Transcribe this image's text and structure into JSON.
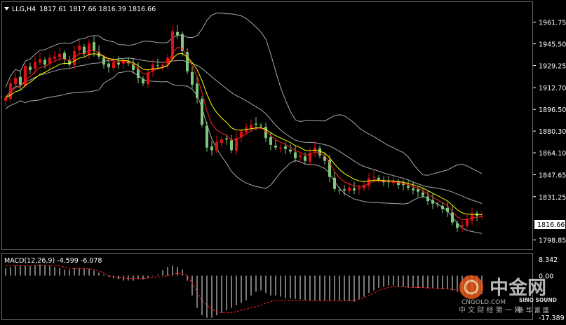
{
  "header": {
    "symbol_timeframe": "LLG,H4",
    "ohlc": "1817.61 1817.66 1816.39 1816.66"
  },
  "colors": {
    "background": "#000000",
    "up_candle": "#e01010",
    "down_candle": "#7ec87e",
    "bollinger": "#a8a8a8",
    "ma_fast": "#ffff00",
    "ma_slow": "#ff2020",
    "histogram": "#c8c8c8",
    "signal": "#ff2020",
    "price_tag_bg": "#ffffff",
    "axis_text": "#ffffff"
  },
  "price_axis": {
    "ticks": [
      "1961.75",
      "1945.50",
      "1929.25",
      "1912.70",
      "1896.50",
      "1880.30",
      "1864.10",
      "1847.65",
      "1831.25",
      "1798.85"
    ],
    "current_price_tag": "1816.66"
  },
  "macd": {
    "label": "MACD(12,26,9) -4.599 -6.078",
    "ticks": [
      "8.342",
      "0.00",
      "-17.389"
    ]
  },
  "watermark": {
    "brand_cn": "中金网",
    "domain": "CNGOLD.COM",
    "tagline_cn": "中 文 财 经 第 一 网",
    "partner": "SINO SOUND",
    "partner_sub": "新 华 富 盛"
  },
  "chart_data": {
    "type": "candlestick",
    "price_range": [
      1795,
      1972
    ],
    "macd_range": [
      -17.389,
      8.342
    ],
    "closes": [
      1905,
      1916,
      1920,
      1915,
      1929,
      1926,
      1932,
      1934,
      1930,
      1935,
      1936,
      1938,
      1934,
      1930,
      1940,
      1944,
      1938,
      1946,
      1940,
      1936,
      1930,
      1928,
      1932,
      1930,
      1933,
      1931,
      1926,
      1920,
      1916,
      1924,
      1930,
      1929,
      1930,
      1935,
      1955,
      1952,
      1940,
      1925,
      1915,
      1905,
      1885,
      1868,
      1866,
      1872,
      1874,
      1874,
      1866,
      1875,
      1880,
      1883,
      1885,
      1885,
      1884,
      1875,
      1870,
      1868,
      1868,
      1867,
      1865,
      1860,
      1862,
      1858,
      1864,
      1868,
      1862,
      1858,
      1846,
      1837,
      1836,
      1836,
      1838,
      1836,
      1838,
      1840,
      1845,
      1846,
      1844,
      1842,
      1842,
      1843,
      1840,
      1840,
      1838,
      1836,
      1835,
      1832,
      1828,
      1826,
      1825,
      1822,
      1820,
      1812,
      1808,
      1810,
      1814,
      1818,
      1817,
      1817
    ],
    "macd_hist": [
      3,
      3.5,
      4,
      4.2,
      4,
      3.8,
      4.2,
      4.5,
      4.3,
      4,
      3.5,
      3,
      2.5,
      2.5,
      3,
      3.2,
      3,
      2.8,
      2,
      1.2,
      0.5,
      -0.5,
      -1,
      -1.5,
      -2,
      -2,
      -2,
      -1.5,
      -1.5,
      -0.8,
      -0.2,
      0.3,
      2.2,
      3.5,
      4,
      3.5,
      2.5,
      -2,
      -8,
      -13,
      -16,
      -17,
      -17,
      -16,
      -15,
      -14,
      -13,
      -12,
      -11,
      -10,
      -8,
      -6.5,
      -6,
      -7,
      -8,
      -8,
      -8.5,
      -9,
      -9.2,
      -9.4,
      -9.6,
      -9.8,
      -10,
      -10,
      -10,
      -10,
      -10,
      -10,
      -10,
      -10.2,
      -10.3,
      -10.5,
      -9.5,
      -8.5,
      -7,
      -6,
      -5,
      -4.5,
      -4,
      -4,
      -4.5,
      -4.5,
      -5,
      -5,
      -5,
      -5,
      -5,
      -5,
      -5.5,
      -5.5,
      -5.5,
      -6,
      -6.5,
      -7,
      -7.5,
      -8,
      -8,
      -7.5
    ],
    "macd_signal": [
      4,
      4,
      4,
      4,
      4,
      4,
      4,
      4,
      4,
      4,
      4,
      4,
      3.5,
      3,
      2.8,
      2.8,
      2.8,
      2.8,
      2.5,
      2,
      1,
      0,
      -0.5,
      -0.8,
      -1,
      -1.2,
      -1.2,
      -1.2,
      -1.2,
      -1,
      -0.8,
      -0.5,
      -0.5,
      0,
      0.5,
      1,
      0.8,
      0,
      -3,
      -6.5,
      -10,
      -12,
      -13.5,
      -14.5,
      -15,
      -15,
      -15,
      -14.5,
      -14,
      -13.5,
      -13,
      -12.5,
      -12,
      -11,
      -10.5,
      -10,
      -10,
      -10,
      -10,
      -10,
      -10,
      -10,
      -10.2,
      -10.2,
      -10.2,
      -10.2,
      -10.2,
      -10.2,
      -10.2,
      -10.2,
      -10,
      -10,
      -9.5,
      -9,
      -8,
      -7,
      -6,
      -5.3,
      -4.8,
      -4.5,
      -4.5,
      -4.5,
      -4.7,
      -4.8,
      -4.8,
      -4.8,
      -5,
      -5,
      -5,
      -5.2,
      -5.3,
      -5.6,
      -5.8,
      -6,
      -6.3,
      -6.6,
      -6.8,
      -7
    ]
  }
}
